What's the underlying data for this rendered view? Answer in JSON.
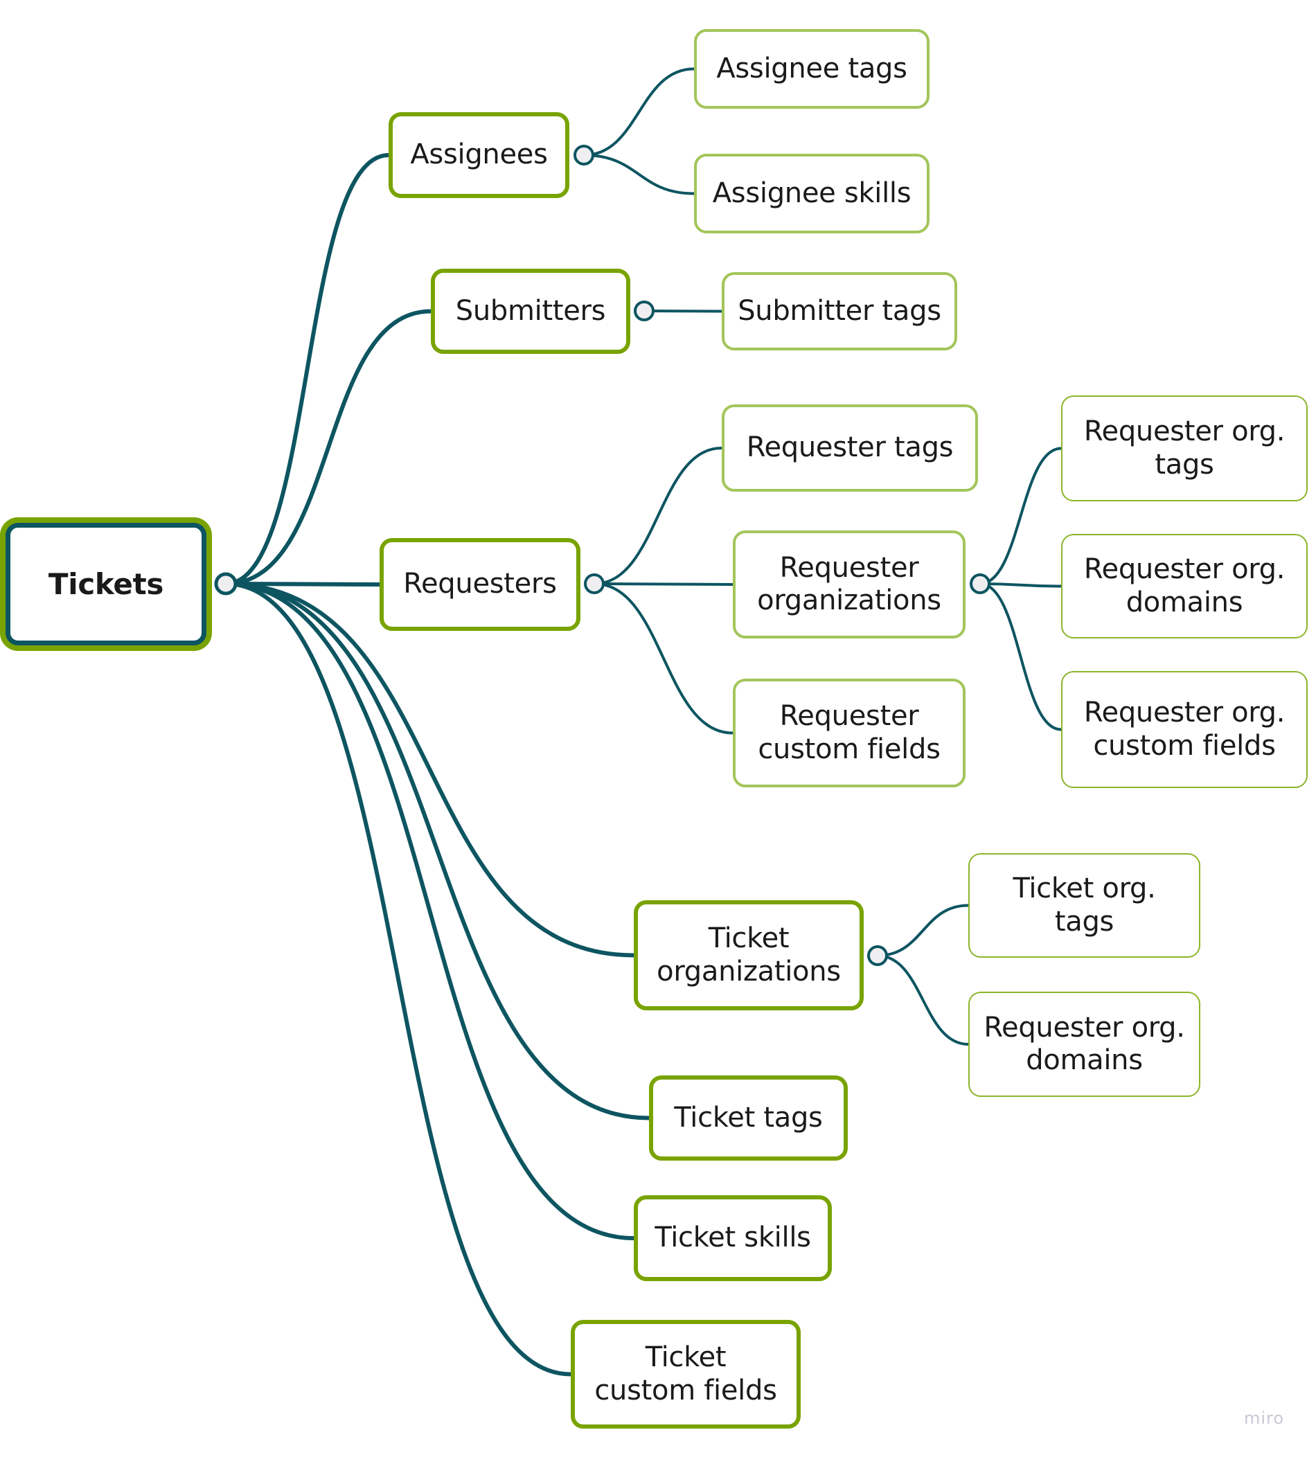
{
  "diagram": {
    "type": "mind-map",
    "colors": {
      "connector": "#0d5561",
      "primary_border": "#79a300",
      "secondary_border": "#a3c55a",
      "tertiary_border": "#8cb52a",
      "node_fill": "#ffffff",
      "handle_fill": "#efeff1",
      "text": "#1a1a1a"
    },
    "root": {
      "id": "tickets",
      "label": "Tickets"
    },
    "nodes": [
      {
        "id": "assignees",
        "label": "Assignees",
        "parent": "tickets",
        "level": 1
      },
      {
        "id": "assignee-tags",
        "label": "Assignee tags",
        "parent": "assignees",
        "level": 2
      },
      {
        "id": "assignee-skills",
        "label": "Assignee skills",
        "parent": "assignees",
        "level": 2
      },
      {
        "id": "submitters",
        "label": "Submitters",
        "parent": "tickets",
        "level": 1
      },
      {
        "id": "submitter-tags",
        "label": "Submitter tags",
        "parent": "submitters",
        "level": 2
      },
      {
        "id": "requesters",
        "label": "Requesters",
        "parent": "tickets",
        "level": 1
      },
      {
        "id": "requester-tags",
        "label": "Requester tags",
        "parent": "requesters",
        "level": 2
      },
      {
        "id": "requester-organizations",
        "label": "Requester\norganizations",
        "parent": "requesters",
        "level": 2
      },
      {
        "id": "requester-custom-fields",
        "label": "Requester\ncustom fields",
        "parent": "requesters",
        "level": 2
      },
      {
        "id": "requester-org-tags",
        "label": "Requester org.\ntags",
        "parent": "requester-organizations",
        "level": 3
      },
      {
        "id": "requester-org-domains",
        "label": "Requester org.\ndomains",
        "parent": "requester-organizations",
        "level": 3
      },
      {
        "id": "requester-org-custom-fields",
        "label": "Requester org.\ncustom fields",
        "parent": "requester-organizations",
        "level": 3
      },
      {
        "id": "ticket-organizations",
        "label": "Ticket\norganizations",
        "parent": "tickets",
        "level": 1
      },
      {
        "id": "ticket-org-tags",
        "label": "Ticket org.\ntags",
        "parent": "ticket-organizations",
        "level": 3
      },
      {
        "id": "ticket-org-requester-org-domains",
        "label": "Requester org.\ndomains",
        "parent": "ticket-organizations",
        "level": 3
      },
      {
        "id": "ticket-tags",
        "label": "Ticket tags",
        "parent": "tickets",
        "level": 1
      },
      {
        "id": "ticket-skills",
        "label": "Ticket skills",
        "parent": "tickets",
        "level": 1
      },
      {
        "id": "ticket-custom-fields",
        "label": "Ticket\ncustom fields",
        "parent": "tickets",
        "level": 1
      }
    ]
  },
  "watermark": "miro"
}
